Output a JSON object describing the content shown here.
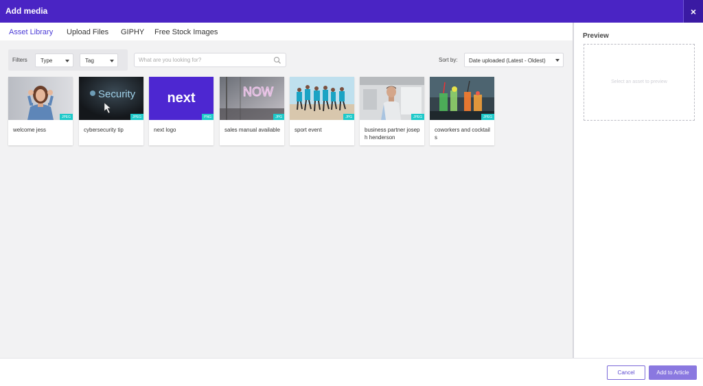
{
  "dialog": {
    "title": "Add media",
    "close_label": "×"
  },
  "tabs": [
    {
      "label": "Asset Library",
      "active": true
    },
    {
      "label": "Upload Files",
      "active": false
    },
    {
      "label": "GIPHY",
      "active": false
    },
    {
      "label": "Free Stock Images",
      "active": false
    }
  ],
  "filters": {
    "label": "Filters",
    "type": {
      "value": "Type"
    },
    "tag": {
      "value": "Tag"
    }
  },
  "search": {
    "placeholder": "What are you looking for?",
    "value": ""
  },
  "sort": {
    "label": "Sort by:",
    "value": "Date uploaded (Latest - Oldest)"
  },
  "assets": [
    {
      "caption": "welcome jess",
      "format": "JPEG",
      "icon": "woman-photo"
    },
    {
      "caption": "cybersecurity tip",
      "format": "JPEG",
      "icon": "security-screen-photo"
    },
    {
      "caption": "next logo",
      "format": "PNG",
      "icon": "next-logo",
      "logo_text": "next"
    },
    {
      "caption": "sales manual available",
      "format": "JPG",
      "icon": "neon-sign-photo",
      "neon_text": "NOW"
    },
    {
      "caption": "sport event",
      "format": "JPG",
      "icon": "runners-photo"
    },
    {
      "caption": "business partner joseph henderson",
      "format": "JPEG",
      "icon": "businessman-photo"
    },
    {
      "caption": "coworkers and cocktails",
      "format": "JPEG",
      "icon": "cocktails-photo"
    }
  ],
  "preview": {
    "title": "Preview",
    "empty_text": "Select an asset to preview"
  },
  "footer": {
    "cancel_label": "Cancel",
    "add_label": "Add to Article"
  },
  "colors": {
    "header": "#4a24c4",
    "accent": "#4a3ad6",
    "badge": "#1ec9c9",
    "primary_button": "#8a78e0"
  }
}
